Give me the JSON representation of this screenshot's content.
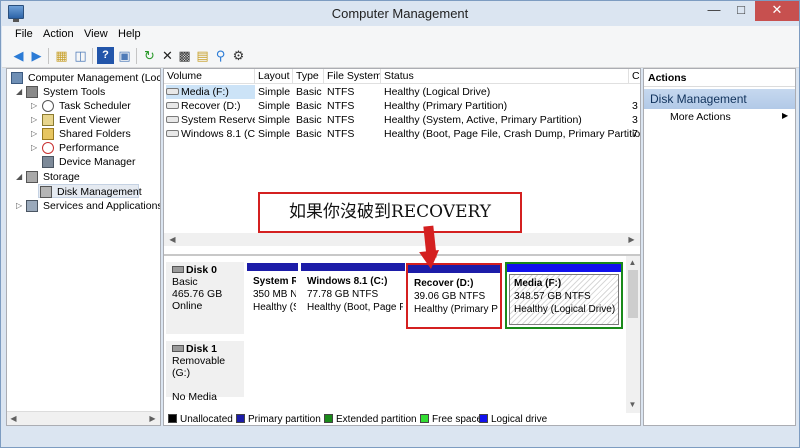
{
  "window": {
    "title": "Computer Management"
  },
  "menu": [
    "File",
    "Action",
    "View",
    "Help"
  ],
  "toolbar_icons": [
    "back-icon",
    "forward-icon",
    "up-icon",
    "show-tree-icon",
    "help-icon",
    "properties-icon",
    "refresh-icon",
    "delete-icon",
    "properties-sheet-icon",
    "open-folder-icon",
    "search-icon",
    "zoom-icon"
  ],
  "tree": {
    "root": "Computer Management (Local",
    "system_tools": "System Tools",
    "task_scheduler": "Task Scheduler",
    "event_viewer": "Event Viewer",
    "shared_folders": "Shared Folders",
    "performance": "Performance",
    "device_manager": "Device Manager",
    "storage": "Storage",
    "disk_management": "Disk Management",
    "services": "Services and Applications"
  },
  "volume_table": {
    "headers": [
      "Volume",
      "Layout",
      "Type",
      "File System",
      "Status",
      "C"
    ],
    "rows": [
      {
        "volume": "Media (F:)",
        "layout": "Simple",
        "type": "Basic",
        "fs": "NTFS",
        "status": "Healthy (Logical Drive)",
        "c": ""
      },
      {
        "volume": "Recover (D:)",
        "layout": "Simple",
        "type": "Basic",
        "fs": "NTFS",
        "status": "Healthy (Primary Partition)",
        "c": "3"
      },
      {
        "volume": "System Reserved",
        "layout": "Simple",
        "type": "Basic",
        "fs": "NTFS",
        "status": "Healthy (System, Active, Primary Partition)",
        "c": "3"
      },
      {
        "volume": "Windows 8.1 (C:)",
        "layout": "Simple",
        "type": "Basic",
        "fs": "NTFS",
        "status": "Healthy (Boot, Page File, Crash Dump, Primary Partition)",
        "c": "7"
      }
    ]
  },
  "annotation": {
    "text": "如果你沒破到RECOVERY"
  },
  "disks": [
    {
      "name": "Disk 0",
      "type": "Basic",
      "size": "465.76 GB",
      "status": "Online"
    },
    {
      "name": "Disk 1",
      "type": "Removable (G:)",
      "size": "",
      "status": "No Media"
    }
  ],
  "partitions": [
    {
      "name": "System R",
      "size": "350 MB N",
      "status": "Healthy (S"
    },
    {
      "name": "Windows 8.1  (C:)",
      "size": "77.78 GB NTFS",
      "status": "Healthy (Boot, Page F"
    },
    {
      "name": "Recover  (D:)",
      "size": "39.06 GB NTFS",
      "status": "Healthy (Primary Par"
    },
    {
      "name": "Media  (F:)",
      "size": "348.57 GB NTFS",
      "status": "Healthy (Logical Drive)"
    }
  ],
  "legend": [
    {
      "label": "Unallocated",
      "color": "#000000"
    },
    {
      "label": "Primary partition",
      "color": "#1c1ca8"
    },
    {
      "label": "Extended partition",
      "color": "#1a8a1a"
    },
    {
      "label": "Free space",
      "color": "#33dd33"
    },
    {
      "label": "Logical drive",
      "color": "#1111ee"
    }
  ],
  "actions": {
    "title": "Actions",
    "section": "Disk Management",
    "more": "More Actions"
  },
  "colors": {
    "highlight": "#d42020",
    "primary": "#1c1ca8",
    "logical": "#1111ee",
    "extended": "#1a8a1a"
  }
}
